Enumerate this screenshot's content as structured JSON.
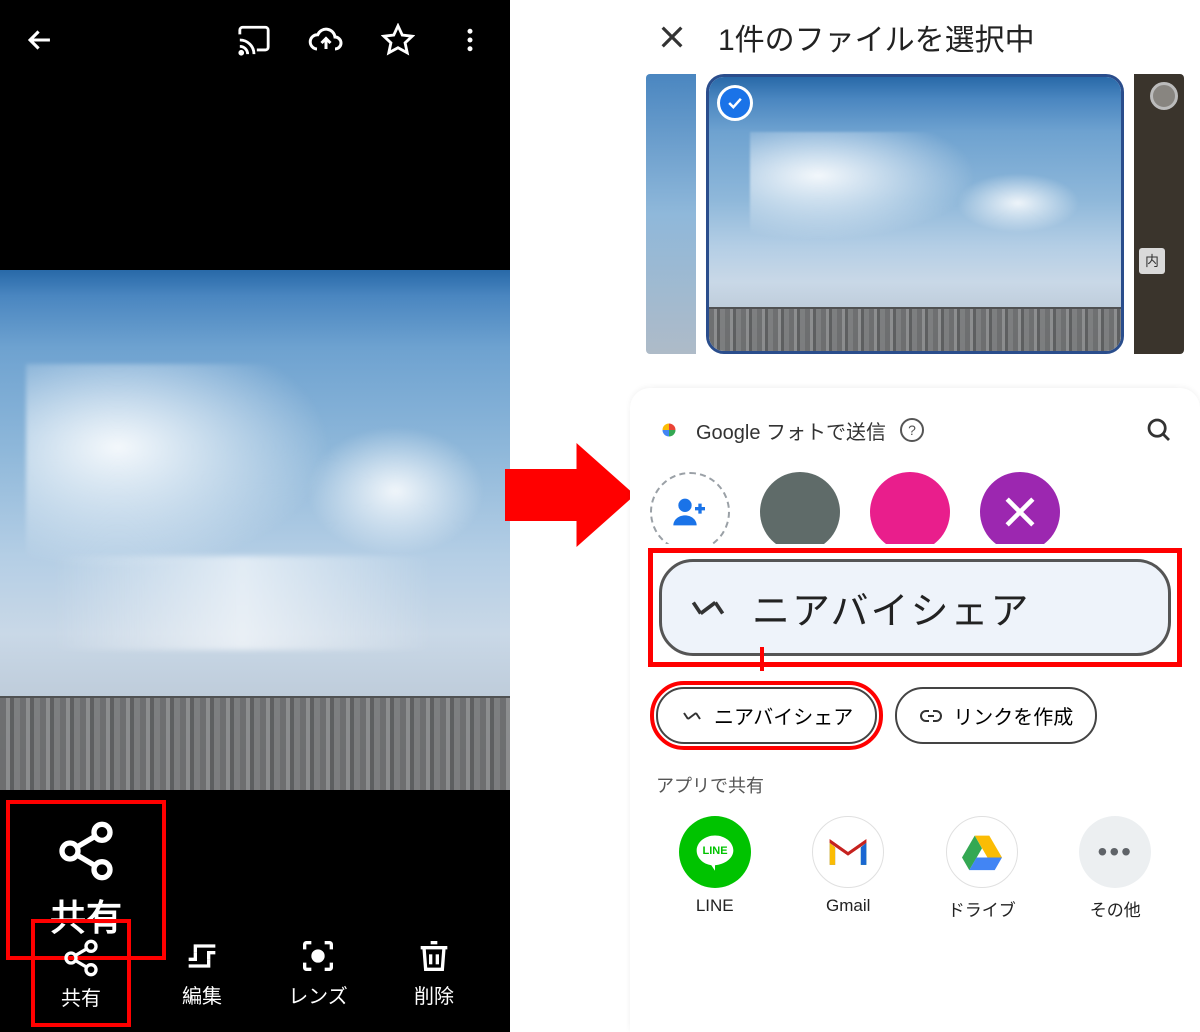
{
  "left": {
    "callout_label": "共有",
    "bottom": {
      "share": "共有",
      "edit": "編集",
      "lens": "レンズ",
      "delete": "削除"
    }
  },
  "right": {
    "header_title": "1件のファイルを選択中",
    "thumb_tag": "内",
    "google_photos": "Google フォトで送信",
    "nearby_zoom": "ニアバイシェア",
    "chip_nearby": "ニアバイシェア",
    "chip_link": "リンクを作成",
    "app_share_label": "アプリで共有",
    "apps": {
      "line": "LINE",
      "gmail": "Gmail",
      "drive": "ドライブ",
      "more": "その他"
    }
  }
}
